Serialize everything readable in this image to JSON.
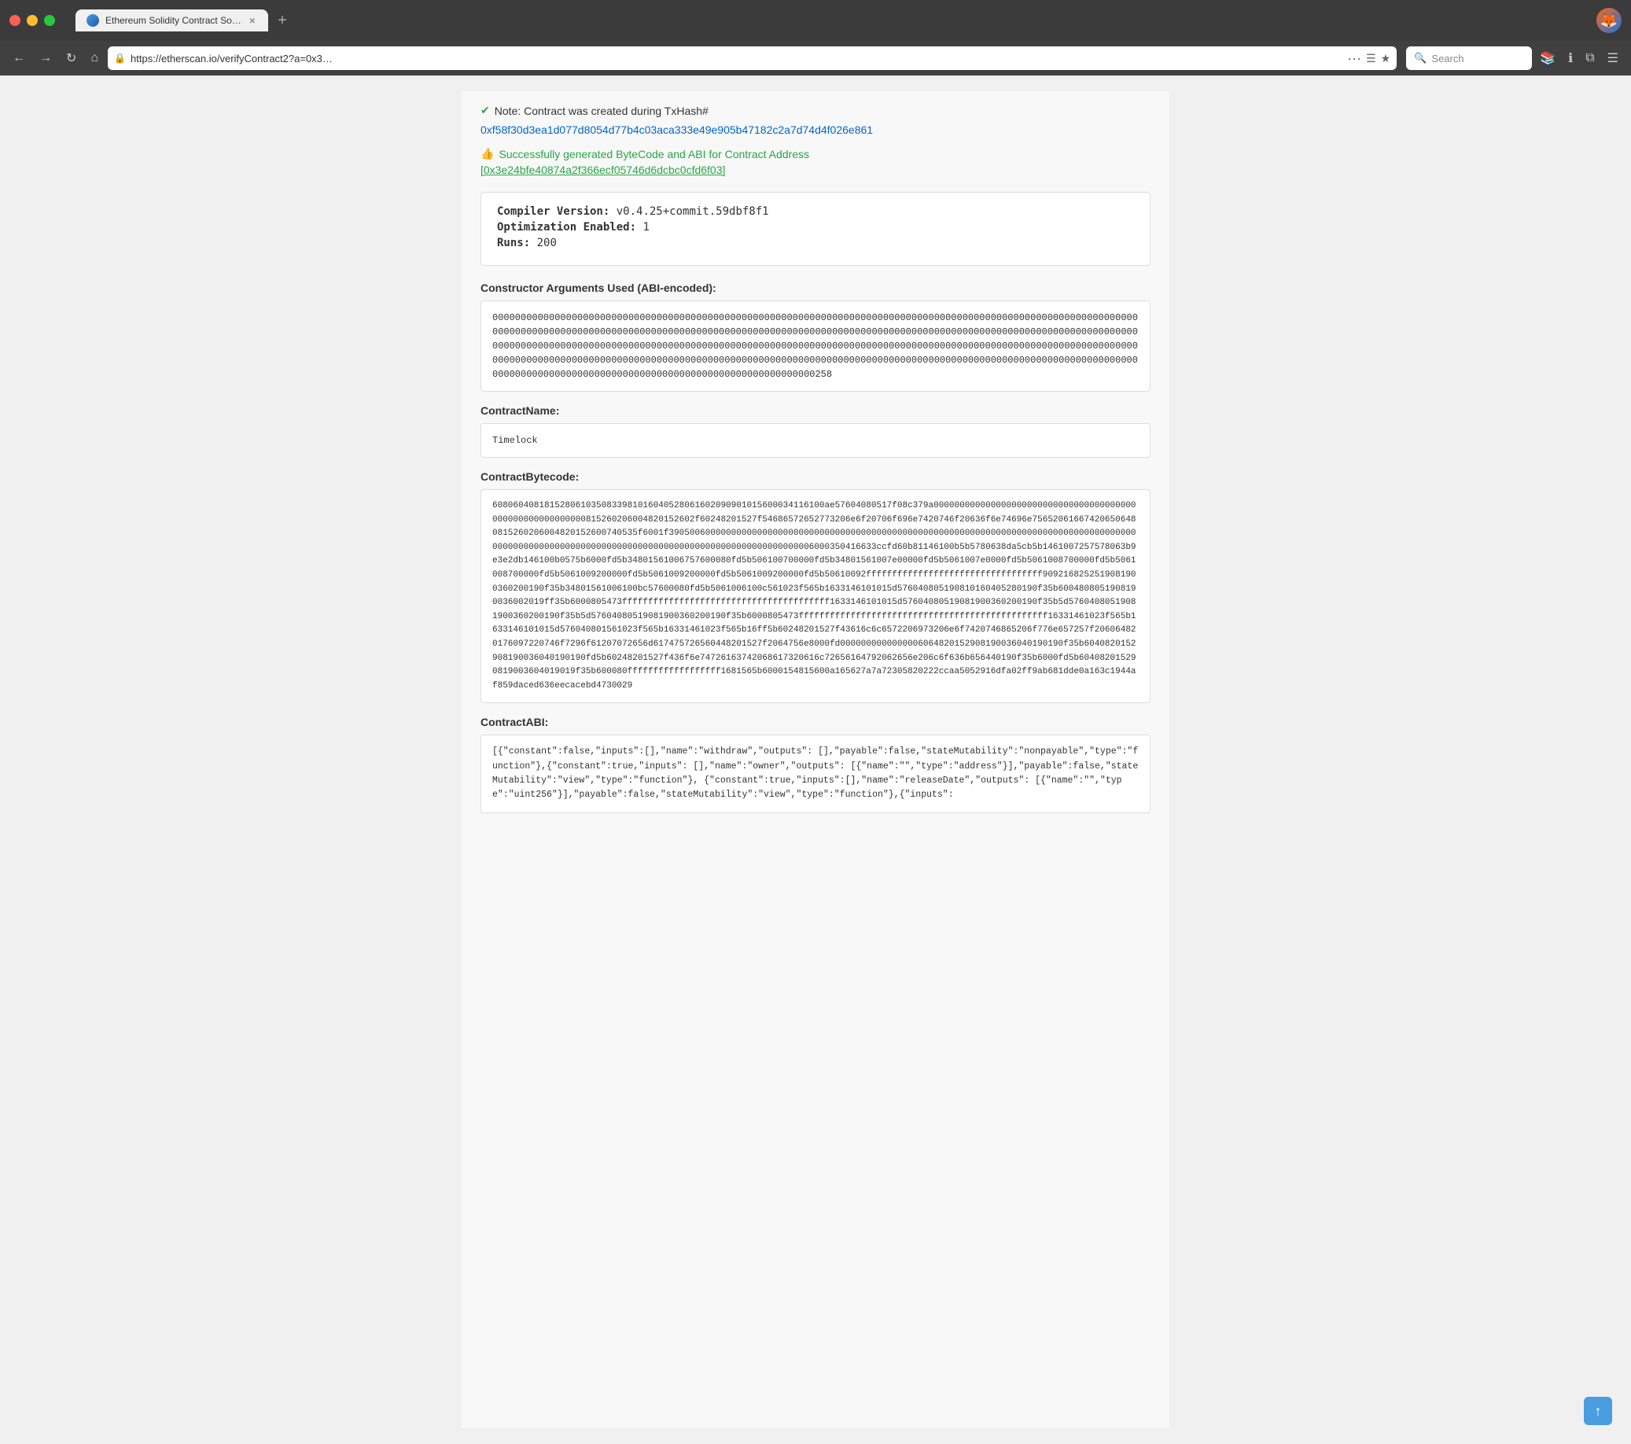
{
  "titlebar": {
    "tab_title": "Ethereum Solidity Contract So…",
    "tab_close": "×",
    "tab_new": "+"
  },
  "navbar": {
    "back": "←",
    "forward": "→",
    "reload": "↻",
    "home": "⌂",
    "address": "https://etherscan.io/verifyContract2?a=0x3…",
    "address_protocol": "https://",
    "address_domain": "etherscan.io",
    "address_path": "/verifyContract2?a=0x3…",
    "more": "···",
    "bookmark": "☰",
    "star": "★",
    "search_placeholder": "Search",
    "library_icon": "📚",
    "info_icon": "ℹ",
    "split_icon": "⧉",
    "menu_icon": "☰"
  },
  "page": {
    "note_text": "Note: Contract was created during TxHash#",
    "tx_hash_link": "0xf58f30d3ea1d077d8054d77b4c03aca333e49e905b47182c2a7d74d4f026e861",
    "success_text": "Successfully generated ByteCode and ABI for Contract Address",
    "contract_address_link": "[0x3e24bfe40874a2f366ecf05746d6dcbc0cfd6f03]",
    "compiler_label": "Compiler Version:",
    "compiler_value": "v0.4.25+commit.59dbf8f1",
    "optimization_label": "Optimization Enabled:",
    "optimization_value": "1",
    "runs_label": "Runs:",
    "runs_value": "200",
    "constructor_args_label": "Constructor Arguments Used (ABI-encoded):",
    "constructor_args_value": "000000000000000000000000000000000000000000000000000000000000000000000000000000000000000000000000000000000000000000000000000000000000000000000000000000000000000000000000000000000000000000000000000000000000000000000000000000000000000000000000000000000000000000000000000000000000000000000000000000000000000000000000000000000000000000000000000000000000000000000000000000000000000000000000000000000000000000000000000000000000000000000000000000000000000000000000000000000000000000000000000000000000000000000000000000000258",
    "contract_name_label": "ContractName:",
    "contract_name_value": "Timelock",
    "contract_bytecode_label": "ContractBytecode:",
    "bytecode_value": "6080604081815280610350833981016040528061602090901015600034116100ae57604080517f08c379a000000000000000000000000000000000000000000000000000000000815260206004820152602f60248201527f54686572652773206e6f20706f696e7420746f20636f6e74696e756520616674206506480815260206004820152600740535f6001f39050060000000000000000000000000000000000000000000000000000000000000000000000000000000000000000000000000000000000000000000000000000000000000000000000006000350416633ccfd60b81146100b5b5780638da5cb5b1461007257578063b9e3e2db146100b0575b6000fd5b34801561006757600080fd5b506100700000fd5b34801561007e00000fd5b5061007e0000fd5b5061008700000fd5b5061008700000fd5b5061009200000fd5b5061009200000fd5b5061009200000fd5b50610092ffffffffffffffffffffffffffffffffff9092168252519081900360200190f35b34801561006100bc57600080fd5b5061006100c561023f565b1633146101015d576040805190810160405280190f35b6004808051908190036002019ff35b6000805473ffffffffffffffffffffffffffffffffffffffff1633146101015d57604080519081900360200190f35b5d57604080519081900360200190f35b5d57604080519081900360200190f35b6000805473ffffffffffffffffffffffffffffffffffffffffffffffff16331461023f565b1633146101015d576040801561023f565b16331461023f565b16ff5b60248201527f43616c6c6572206973206e6f7420746865206f776e657257f206064820176097220746f7296f61207072656d617475726560448201527f2064756e8000fd0000000000000006064820152908190036040190190f35b6040820152908190036040190190fd5b60248201527f436f6e74726163742068617320616c72656164792062656e206c6f636b656440190f35b6000fd5b604082015290819003604019019f35b600080ffffffffffffffffff1681565b6000154815600a165627a7a72305820222ccaa5052916dfa02ff9ab681dde0a163c1944af859daced636eecacebd4730029",
    "contract_abi_label": "ContractABI:",
    "abi_value": "[{\"constant\":false,\"inputs\":[],\"name\":\"withdraw\",\"outputs\":\n[],\"payable\":false,\"stateMutability\":\"nonpayable\",\"type\":\"function\"},{\"constant\":true,\"inputs\":\n[],\"name\":\"owner\",\"outputs\":\n[{\"name\":\"\",\"type\":\"address\"}],\"payable\":false,\"stateMutability\":\"view\",\"type\":\"function\"},\n{\"constant\":true,\"inputs\":[],\"name\":\"releaseDate\",\"outputs\":\n[{\"name\":\"\",\"type\":\"uint256\"}],\"payable\":false,\"stateMutability\":\"view\",\"type\":\"function\"},{\"inputs\":",
    "scroll_top": "↑"
  }
}
